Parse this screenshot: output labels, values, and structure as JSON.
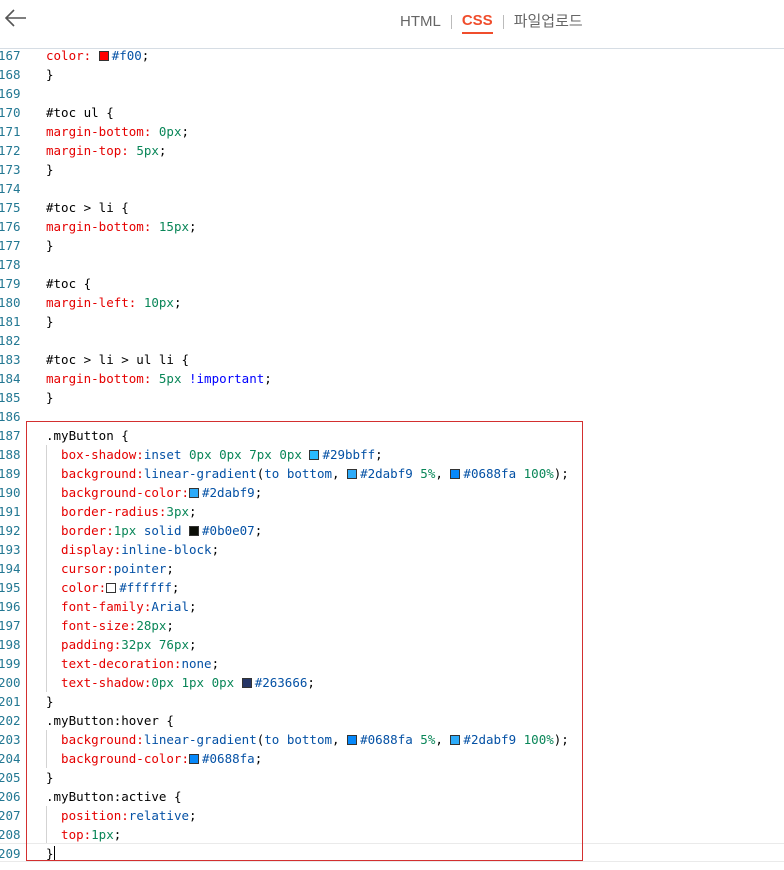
{
  "header": {
    "tabs": [
      {
        "label": "HTML",
        "active": false
      },
      {
        "label": "CSS",
        "active": true
      },
      {
        "label": "파일업로드",
        "active": false
      }
    ]
  },
  "accent_color": "#f04d2c",
  "highlight_color": "#d32f2f",
  "editor": {
    "lines": [
      {
        "n": "167",
        "t": "color: #f00;"
      },
      {
        "n": "168",
        "t": "}"
      },
      {
        "n": "169",
        "t": ""
      },
      {
        "n": "170",
        "t": "#toc ul {"
      },
      {
        "n": "171",
        "t": "margin-bottom: 0px;"
      },
      {
        "n": "172",
        "t": "margin-top: 5px;"
      },
      {
        "n": "173",
        "t": "}"
      },
      {
        "n": "174",
        "t": ""
      },
      {
        "n": "175",
        "t": "#toc > li {"
      },
      {
        "n": "176",
        "t": "margin-bottom: 15px;"
      },
      {
        "n": "177",
        "t": "}"
      },
      {
        "n": "178",
        "t": ""
      },
      {
        "n": "179",
        "t": "#toc {"
      },
      {
        "n": "180",
        "t": "margin-left: 10px;"
      },
      {
        "n": "181",
        "t": "}"
      },
      {
        "n": "182",
        "t": ""
      },
      {
        "n": "183",
        "t": "#toc > li > ul li {"
      },
      {
        "n": "184",
        "t": "margin-bottom: 5px !important;"
      },
      {
        "n": "185",
        "t": "}"
      },
      {
        "n": "186",
        "t": ""
      },
      {
        "n": "187",
        "t": ".myButton {"
      },
      {
        "n": "188",
        "t": "  box-shadow:inset 0px 0px 7px 0px #29bbff;"
      },
      {
        "n": "189",
        "t": "  background:linear-gradient(to bottom, #2dabf9 5%, #0688fa 100%);"
      },
      {
        "n": "190",
        "t": "  background-color:#2dabf9;"
      },
      {
        "n": "191",
        "t": "  border-radius:3px;"
      },
      {
        "n": "192",
        "t": "  border:1px solid #0b0e07;"
      },
      {
        "n": "193",
        "t": "  display:inline-block;"
      },
      {
        "n": "194",
        "t": "  cursor:pointer;"
      },
      {
        "n": "195",
        "t": "  color:#ffffff;"
      },
      {
        "n": "196",
        "t": "  font-family:Arial;"
      },
      {
        "n": "197",
        "t": "  font-size:28px;"
      },
      {
        "n": "198",
        "t": "  padding:32px 76px;"
      },
      {
        "n": "199",
        "t": "  text-decoration:none;"
      },
      {
        "n": "200",
        "t": "  text-shadow:0px 1px 0px #263666;"
      },
      {
        "n": "201",
        "t": "}"
      },
      {
        "n": "202",
        "t": ".myButton:hover {"
      },
      {
        "n": "203",
        "t": "  background:linear-gradient(to bottom, #0688fa 5%, #2dabf9 100%);"
      },
      {
        "n": "204",
        "t": "  background-color:#0688fa;"
      },
      {
        "n": "205",
        "t": "}"
      },
      {
        "n": "206",
        "t": ".myButton:active {"
      },
      {
        "n": "207",
        "t": "  position:relative;"
      },
      {
        "n": "208",
        "t": "  top:1px;"
      },
      {
        "n": "209",
        "t": "}"
      }
    ]
  }
}
